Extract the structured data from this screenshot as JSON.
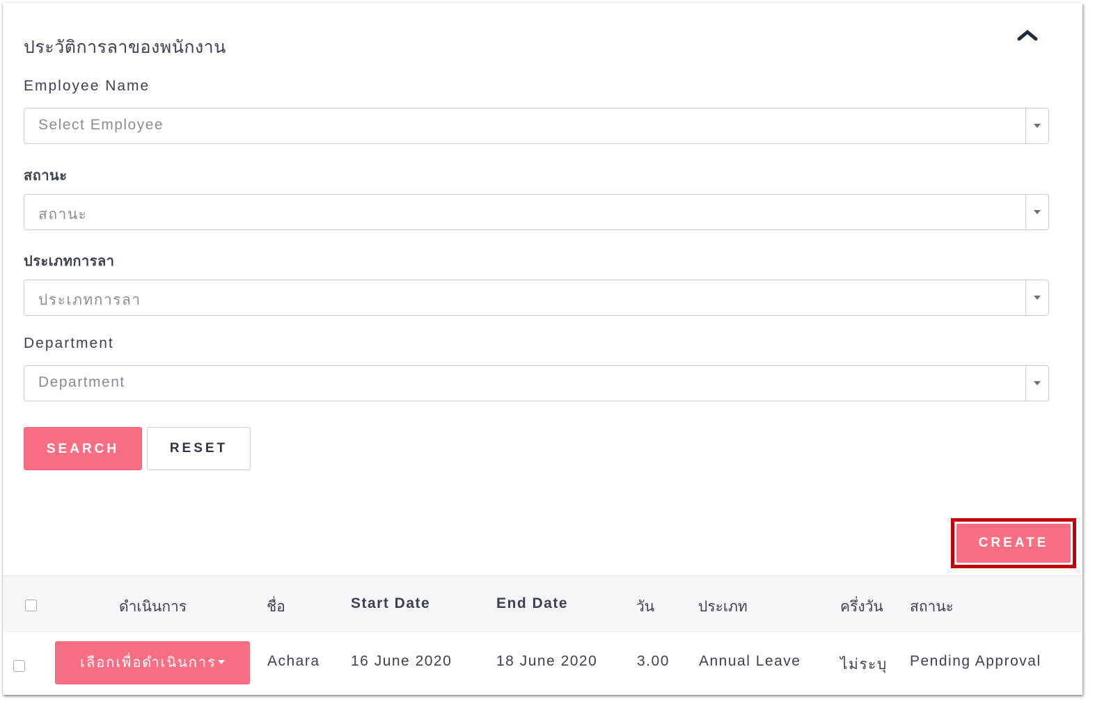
{
  "page_title": "ประวัติการลาของพนักงาน",
  "filters": {
    "employee": {
      "label": "Employee Name",
      "placeholder": "Select Employee"
    },
    "status": {
      "label": "สถานะ",
      "placeholder": "สถานะ"
    },
    "leave_type": {
      "label": "ประเภทการลา",
      "placeholder": "ประเภทการลา"
    },
    "department": {
      "label": "Department",
      "placeholder": "Department"
    }
  },
  "buttons": {
    "search": "SEARCH",
    "reset": "RESET",
    "create": "CREATE"
  },
  "table": {
    "headers": {
      "action": "ดำเนินการ",
      "name": "ชื่อ",
      "start_date": "Start Date",
      "end_date": "End Date",
      "days": "วัน",
      "type": "ประเภท",
      "half_day": "ครึ่งวัน",
      "status": "สถานะ"
    },
    "rows": [
      {
        "action_label": "เลือกเพื่อดำเนินการ",
        "name": "Achara",
        "start_date": "16 June 2020",
        "end_date": "18 June 2020",
        "days": "3.00",
        "type": "Annual Leave",
        "half_day": "ไม่ระบุ",
        "status": "Pending Approval"
      }
    ]
  },
  "colors": {
    "accent": "#f86f84",
    "highlight_border": "#c20008",
    "text": "#3a4250"
  },
  "icons": {
    "collapse": "chevron-up-icon",
    "dropdown": "caret-down-icon"
  }
}
